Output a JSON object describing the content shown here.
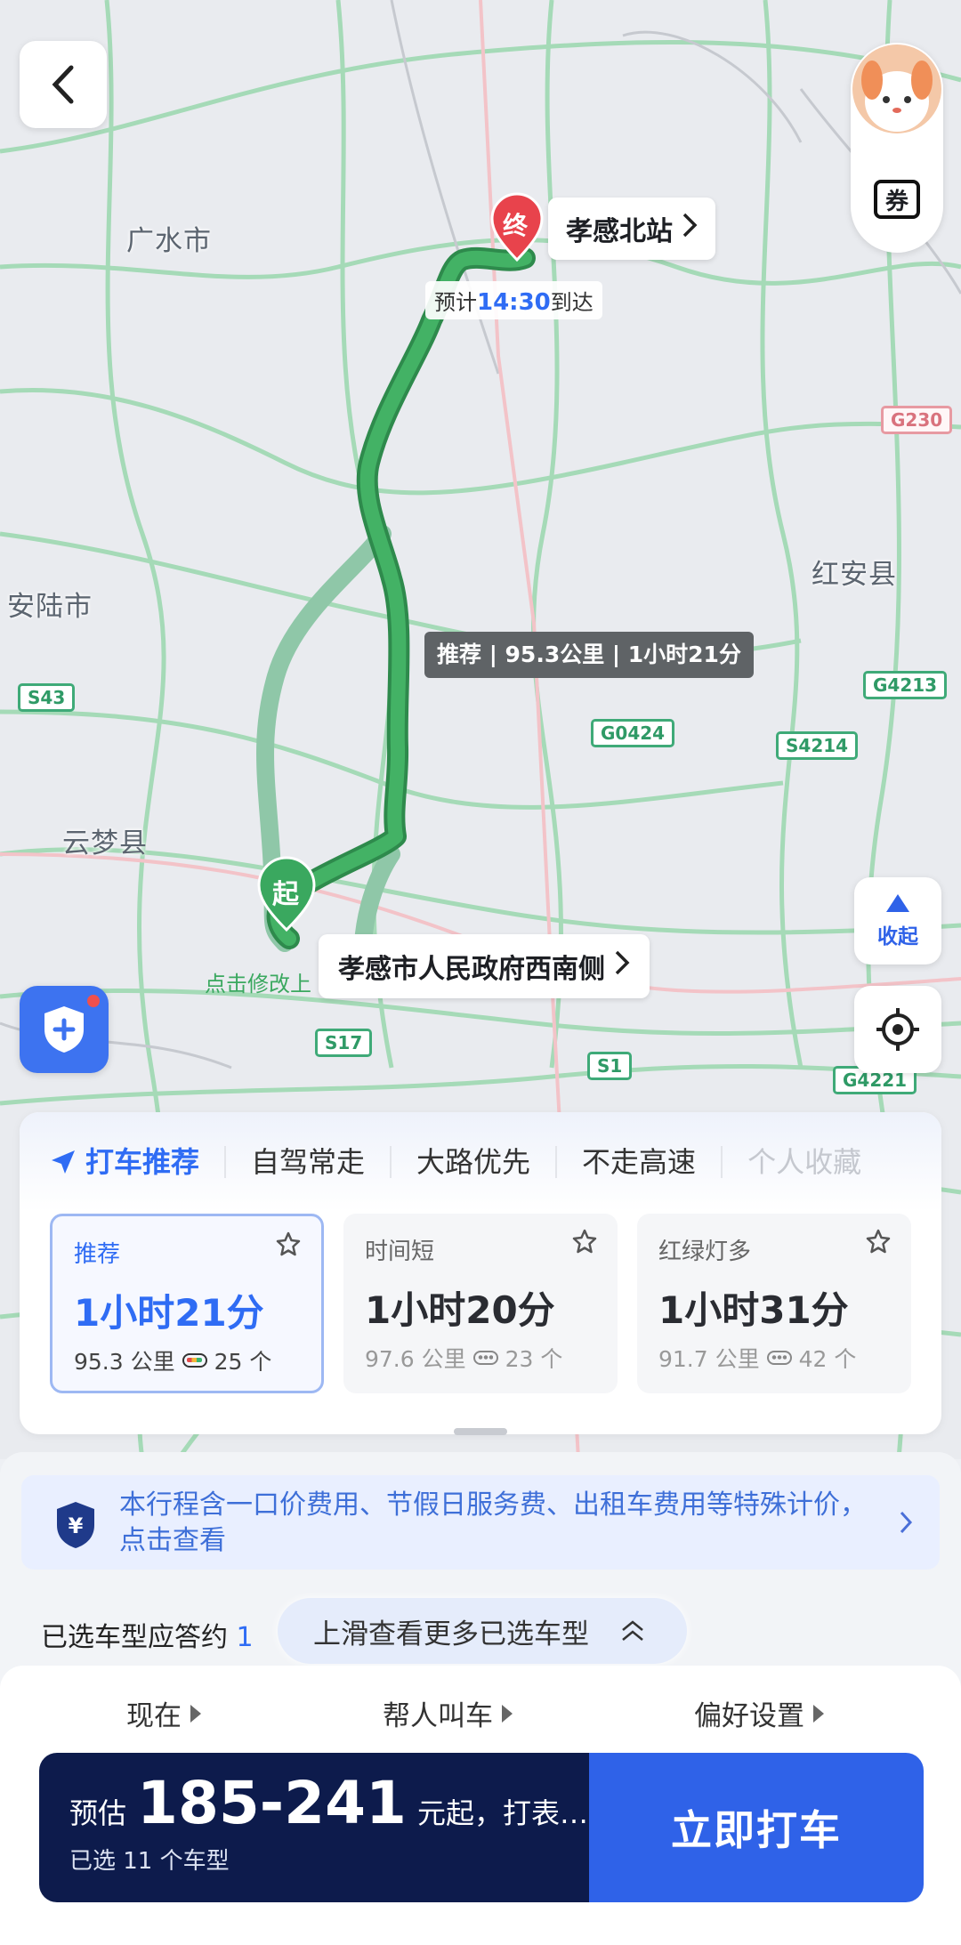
{
  "map": {
    "cities": [
      "广水市",
      "安陆市",
      "云梦县",
      "红安县"
    ],
    "road_shields": [
      "G230",
      "S43",
      "G4213",
      "S4214",
      "G0424",
      "S17",
      "S1",
      "G4221"
    ],
    "destination": {
      "badge": "终",
      "name": "孝感北站"
    },
    "eta": {
      "prefix": "预计",
      "time": "14:30",
      "suffix": "到达"
    },
    "route_tip": "推荐 | 95.3公里 | 1小时21分",
    "origin": {
      "badge": "起",
      "name": "孝感市人民政府西南侧",
      "edit_hint": "点击修改上"
    },
    "coupon_label": "券",
    "collapse_label": "收起",
    "colors": {
      "route": "#3aa85f",
      "alt_route": "#8fc7a8",
      "dest_pin": "#e8434c",
      "origin_pin": "#3aa85f"
    }
  },
  "route_panel": {
    "tabs": [
      "打车推荐",
      "自驾常走",
      "大路优先",
      "不走高速",
      "个人收藏"
    ],
    "cards": [
      {
        "label": "推荐",
        "duration": "1小时21分",
        "distance": "95.3 公里",
        "lights": "25 个"
      },
      {
        "label": "时间短",
        "duration": "1小时20分",
        "distance": "97.6 公里",
        "lights": "23 个"
      },
      {
        "label": "红绿灯多",
        "duration": "1小时31分",
        "distance": "91.7 公里",
        "lights": "42 个"
      }
    ]
  },
  "sheet": {
    "notice": "本行程含一口价费用、节假日服务费、出租车费用等特殊计价，点击查看",
    "selected_prefix": "已选车型应答约",
    "selected_num": "1",
    "hint": "上滑查看更多已选车型",
    "options": [
      "现在",
      "帮人叫车",
      "偏好设置"
    ],
    "price_prefix": "预估",
    "price": "185-241",
    "price_suffix": "元起，打表…",
    "selected_models": "已选 11 个车型",
    "cta": "立即打车"
  }
}
